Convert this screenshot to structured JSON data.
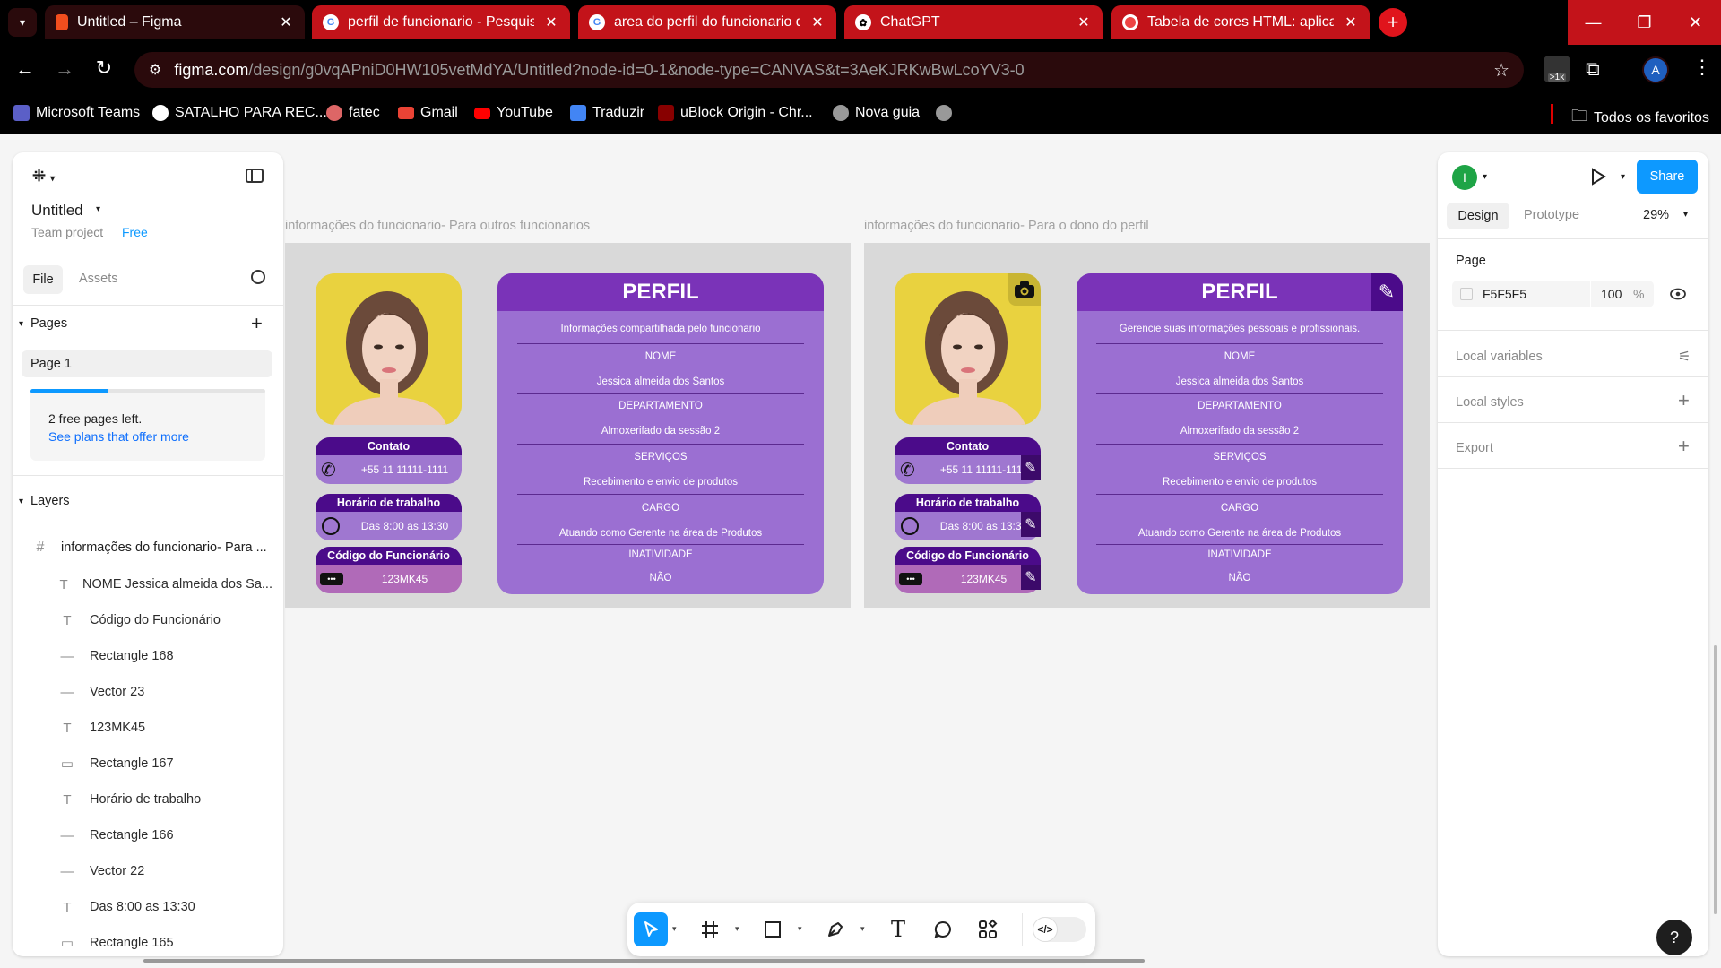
{
  "browser": {
    "tabs": [
      {
        "title": "Untitled – Figma",
        "icon": "figma-icon"
      },
      {
        "title": "perfil de funcionario - Pesquisa",
        "icon": "google-icon"
      },
      {
        "title": "area do perfil do funcionario da",
        "icon": "google-icon"
      },
      {
        "title": "ChatGPT",
        "icon": "chatgpt-icon"
      },
      {
        "title": "Tabela de cores HTML: aplicand",
        "icon": "site-icon"
      }
    ],
    "url_domain": "figma.com",
    "url_path": "/design/g0vqAPniD0HW105vetMdYA/Untitled?node-id=0-1&node-type=CANVAS&t=3AeKJRKwBwLcoYV3-0",
    "ext_badge": ">1k",
    "profile_initial": "A",
    "bookmarks": [
      "Microsoft Teams",
      "SATALHO PARA REC...",
      "fatec",
      "Gmail",
      "YouTube",
      "Traduzir",
      "uBlock Origin - Chr...",
      "Nova guia"
    ],
    "all_bookmarks": "Todos os favoritos"
  },
  "left_panel": {
    "file_name": "Untitled",
    "team": "Team project",
    "plan": "Free",
    "tab_file": "File",
    "tab_assets": "Assets",
    "pages_heading": "Pages",
    "page_item": "Page 1",
    "free_pages_text": "2 free pages left.",
    "free_pages_link": "See plans that offer more",
    "free_pages_progress": 0.33,
    "layers_heading": "Layers",
    "frame_layer": "informações do funcionario- Para ...",
    "layers": [
      {
        "icon": "T",
        "name": "NOME Jessica almeida dos Sa..."
      },
      {
        "icon": "T",
        "name": "Código do Funcionário"
      },
      {
        "icon": "—",
        "name": "Rectangle 168"
      },
      {
        "icon": "—",
        "name": "Vector 23"
      },
      {
        "icon": "T",
        "name": "123MK45"
      },
      {
        "icon": "▭",
        "name": "Rectangle 167"
      },
      {
        "icon": "T",
        "name": "Horário de trabalho"
      },
      {
        "icon": "—",
        "name": "Rectangle 166"
      },
      {
        "icon": "—",
        "name": "Vector 22"
      },
      {
        "icon": "T",
        "name": "Das 8:00 as 13:30"
      },
      {
        "icon": "▭",
        "name": "Rectangle 165"
      }
    ]
  },
  "canvas": {
    "frames": [
      {
        "label": "informações do funcionario- Para outros funcionarios",
        "owner_view": false,
        "card_subtitle": "Informações compartilhada pelo funcionario"
      },
      {
        "label": "informações do funcionario- Para o dono do perfil",
        "owner_view": true,
        "card_subtitle": "Gerencie suas informações pessoais e profissionais."
      }
    ],
    "profile": {
      "title": "PERFIL",
      "nome_label": "NOME",
      "nome": "Jessica almeida dos Santos",
      "dep_label": "DEPARTAMENTO",
      "dep": "Almoxerifado da sessão 2",
      "serv_label": "SERVIÇOS",
      "serv": "Recebimento e envio de produtos",
      "cargo_label": "CARGO",
      "cargo": "Atuando como Gerente na área de Produtos",
      "inat_label": "INATIVIDADE",
      "inat": "NÃO",
      "contato_label": "Contato",
      "contato": "+55 11 11111-1111",
      "horario_label": "Horário de trabalho",
      "horario": "Das 8:00 as 13:30",
      "codigo_label": "Código do Funcionário",
      "codigo": "123MK45"
    }
  },
  "right_panel": {
    "user_initial": "I",
    "share": "Share",
    "tab_design": "Design",
    "tab_prototype": "Prototype",
    "zoom": "29%",
    "page_heading": "Page",
    "page_color": "F5F5F5",
    "page_opacity": "100",
    "percent": "%",
    "local_variables": "Local variables",
    "local_styles": "Local styles",
    "export": "Export"
  },
  "help": "?",
  "colors": {
    "purple_dark": "#4b0b8a",
    "card": "#9b6fd2",
    "accent": "#0d99ff",
    "chrome_red": "#c3131a"
  }
}
